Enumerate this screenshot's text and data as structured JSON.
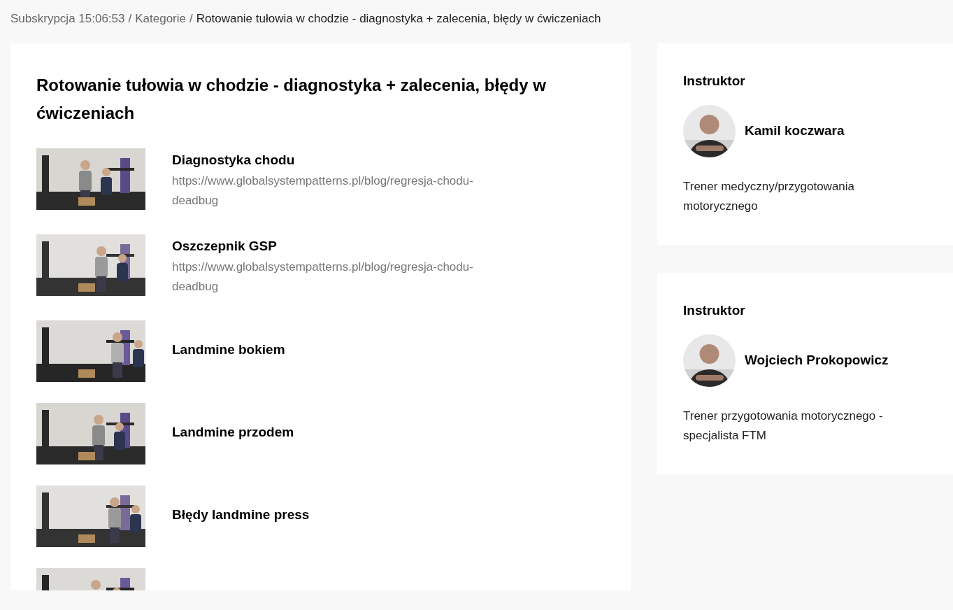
{
  "breadcrumb": [
    {
      "label": "Subskrypcja 15:06:53",
      "kind": "link"
    },
    {
      "label": "/",
      "kind": "separator"
    },
    {
      "label": "Kategorie",
      "kind": "link"
    },
    {
      "label": "/",
      "kind": "separator"
    },
    {
      "label": "Rotowanie tułowia w chodzie - diagnostyka + zalecenia, błędy w ćwiczeniach",
      "kind": "current"
    }
  ],
  "course": {
    "title": "Rotowanie tułowia w chodzie - diagnostyka + zalecenia, błędy w ćwiczeniach",
    "lessons": [
      {
        "title": "Diagnostyka chodu",
        "url": "https://www.globalsystempatterns.pl/blog/regresja-chodu-deadbug",
        "thumbnail": {
          "kind": "picture"
        }
      },
      {
        "title": "Oszczepnik GSP",
        "url": "https://www.globalsystempatterns.pl/blog/regresja-chodu-deadbug",
        "thumbnail": {
          "kind": "picture"
        }
      },
      {
        "title": "Landmine bokiem",
        "thumbnail": {
          "kind": "picture"
        }
      },
      {
        "title": "Landmine przodem",
        "thumbnail": {
          "kind": "picture"
        }
      },
      {
        "title": "Błędy landmine press",
        "thumbnail": {
          "kind": "picture"
        }
      },
      {
        "thumbnail": {
          "kind": "picture"
        }
      }
    ]
  },
  "instructors": [
    {
      "heading": "Instruktor",
      "name": "Kamil koczwara",
      "description": "Trener medyczny/przygotowania motorycznego",
      "avatar": {
        "kind": "picture"
      }
    },
    {
      "heading": "Instruktor",
      "name": "Wojciech Prokopowicz",
      "description": "Trener przygotowania motorycznego - specjalista FTM",
      "avatar": {
        "kind": "picture"
      }
    }
  ]
}
